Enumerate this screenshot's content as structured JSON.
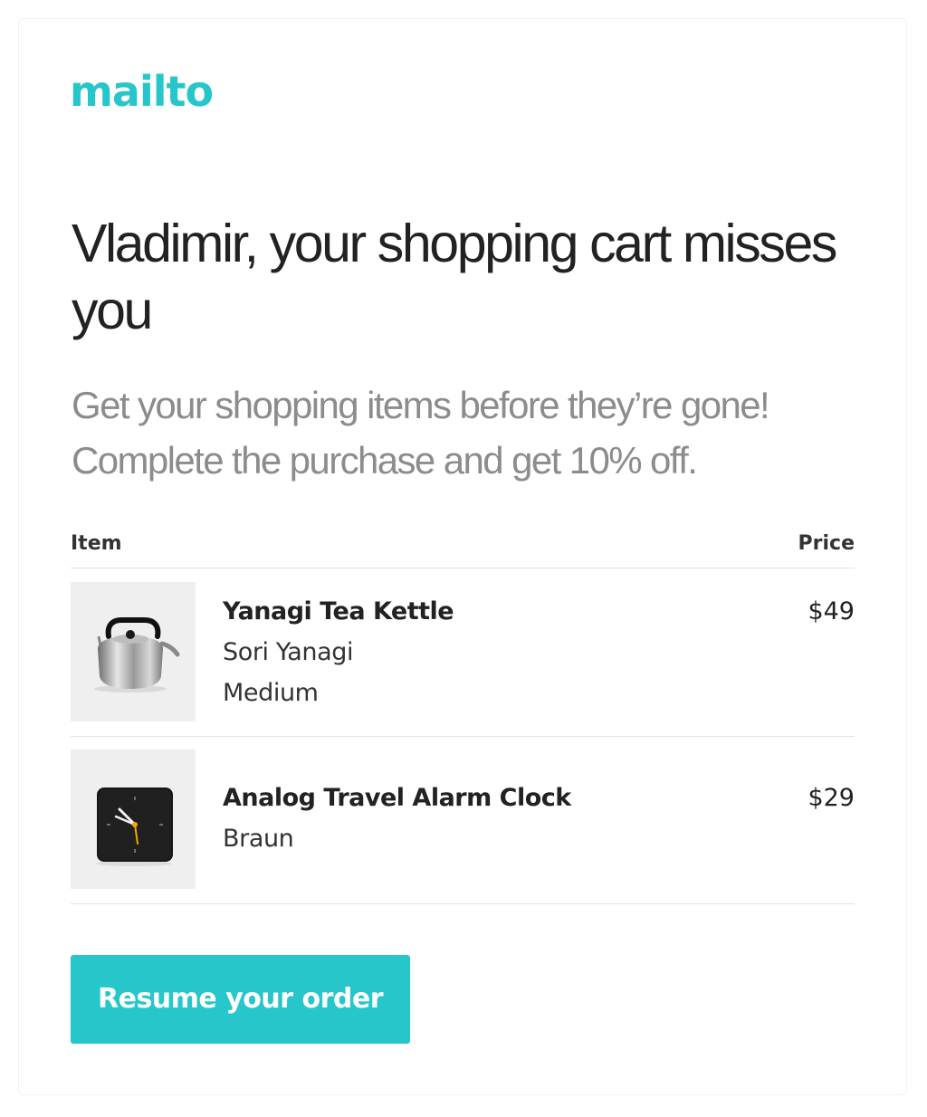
{
  "brand": {
    "logo_text": "mailto",
    "accent_color": "#26c6cb"
  },
  "hero": {
    "headline": "Vladimir, your shopping cart misses you",
    "subhead": "Get your shopping items before they’re gone! Complete the purchase and get 10% off."
  },
  "cart": {
    "columns": {
      "item": "Item",
      "price": "Price"
    },
    "items": [
      {
        "name": "Yanagi Tea Kettle",
        "brand": "Sori Yanagi",
        "variant": "Medium",
        "price": "$49",
        "image_icon": "kettle-icon"
      },
      {
        "name": "Analog Travel Alarm Clock",
        "brand": "Braun",
        "price": "$29",
        "image_icon": "alarm-clock-icon"
      }
    ]
  },
  "cta": {
    "label": "Resume your order"
  }
}
